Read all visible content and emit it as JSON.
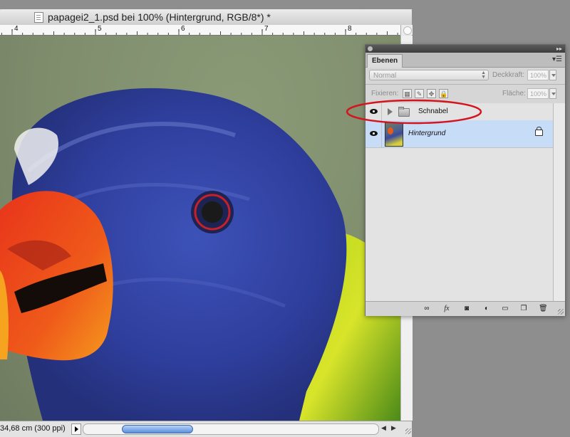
{
  "document": {
    "title": "papagei2_1.psd bei 100% (Hintergrund, RGB/8*) *",
    "ruler_numbers": [
      "4",
      "5",
      "6",
      "7",
      "8"
    ],
    "status_text": "34,68 cm (300 ppi)"
  },
  "layers_panel": {
    "tab_label": "Ebenen",
    "blend_mode": "Normal",
    "opacity_label": "Deckkraft:",
    "opacity_value": "100%",
    "lock_label": "Fixieren:",
    "fill_label": "Fläche:",
    "fill_value": "100%",
    "layers": [
      {
        "name": "Schnabel",
        "type": "group",
        "visible": true
      },
      {
        "name": "Hintergrund",
        "type": "image",
        "visible": true,
        "locked": true,
        "selected": true
      }
    ],
    "bottom_icons": [
      "link-icon",
      "fx-icon",
      "mask-icon",
      "adjustment-icon",
      "folder-icon",
      "new-layer-icon",
      "trash-icon"
    ]
  },
  "annotation": {
    "color": "#d4141e",
    "target": "Schnabel"
  }
}
